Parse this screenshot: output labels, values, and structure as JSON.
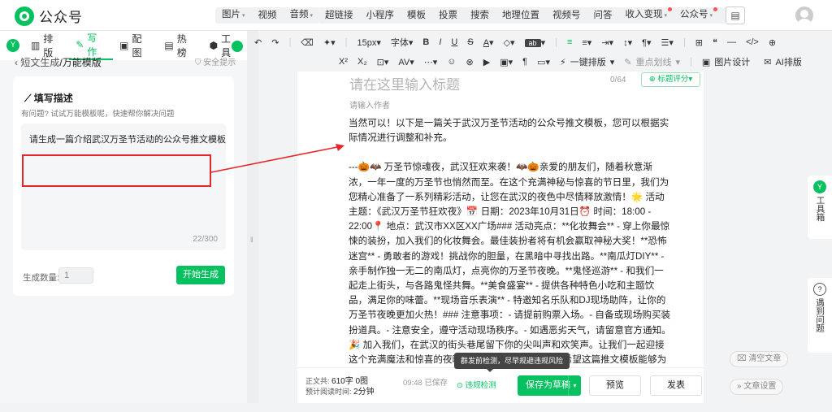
{
  "app": {
    "name": "公众号"
  },
  "nav1": [
    "图片",
    "视频",
    "音频"
  ],
  "nav2": [
    "超链接",
    "小程序",
    "模板",
    "投票",
    "搜索",
    "地理位置",
    "视频号",
    "问答",
    "收入变现",
    "公众号",
    "···"
  ],
  "left": {
    "tabs": [
      "排版",
      "写作",
      "配图",
      "热榜",
      "工具"
    ],
    "breadcrumb_prefix": "短文生成",
    "breadcrumb_current": "/万能模版",
    "safety": "安全提示",
    "card_title": "填写描述",
    "card_sub": "有问题? 试试万能模板呢，快速帮你解决问题",
    "input_value": "请生成一篇介绍武汉万圣节活动的公众号推文模板",
    "char_count": "22/300",
    "gen_label": "生成数量:",
    "gen_value": "1",
    "gen_button": "开始生成"
  },
  "toolbar": {
    "row1": [
      "↶",
      "↷",
      "|",
      "◆",
      "▾",
      "|",
      "15px",
      "字体",
      "B",
      "I",
      "U",
      "S",
      "A",
      "◇",
      "ab",
      "|",
      "≡",
      "≡",
      "≡",
      "|",
      "¶",
      "|",
      "≣",
      "|",
      "⊞",
      "“",
      "—",
      "</>",
      "⊕"
    ],
    "row2": [
      "X²",
      "X₂",
      "|",
      "A▾",
      "|",
      "⌚",
      "☺",
      "⊕",
      "▶",
      "▣",
      "|",
      "一键排版",
      "重点划线",
      "|",
      "图片设计",
      "AI排版"
    ]
  },
  "editor": {
    "title_placeholder": "请在这里输入标题",
    "title_count": "0/64",
    "score_label": "标题评分",
    "author_placeholder": "请输入作者",
    "p1": "当然可以！以下是一篇关于武汉万圣节活动的公众号推文模板，您可以根据实际情况进行调整和补充。",
    "p2": "---🎃🦇 万圣节惊魂夜，武汉狂欢来袭！🦇🎃亲爱的朋友们，随着秋意渐浓，一年一度的万圣节也悄然而至。在这个充满神秘与惊喜的节日里，我们为您精心准备了一系列精彩活动，让您在武汉的夜色中尽情释放激情！🌟 活动主题：《武汉万圣节狂欢夜》📅 日期：2023年10月31日⏰ 时间：18:00 - 22:00📍 地点：武汉市XX区XX广场### 活动亮点：**化妆舞会** - 穿上你最惊悚的装扮，加入我们的化妆舞会。最佳装扮者将有机会赢取神秘大奖！**恐怖迷宫** - 勇敢者的游戏！挑战你的胆量，在黑暗中寻找出路。**南瓜灯DIY** - 亲手制作独一无二的南瓜灯，点亮你的万圣节夜晚。**鬼怪巡游** - 和我们一起走上街头，与各路鬼怪共舞。**美食盛宴** - 提供各种特色小吃和主题饮品，满足你的味蕾。**现场音乐表演** - 特邀知名乐队和DJ现场助阵，让你的万圣节夜晚更加火热！### 注意事项：- 请提前购票入场。- 自备或现场购买装扮道具。- 注意安全，遵守活动现场秩序。- 如遇恶劣天气，请留意官方通知。🎉 加入我们，在武汉的街头巷尾留下你的尖叫声和欢笑声。让我们一起迎接这个充满魔法和惊喜的夜晚！🎟️ [点击购票](链接)---希望这篇推文模板能够为您的活动宣传提供帮助。记得在发布前检查所有细节是否准确无误，并确保所有链接都是有效的。祝您的活动圆满成功！"
  },
  "footer": {
    "text_label": "正文共:",
    "text_value": "610字 0图",
    "read_label": "预计阅读时间:",
    "read_value": "2分钟",
    "saved": "09:48 已保存",
    "check": "违规检测",
    "save": "保存为草稿",
    "preview": "预览",
    "publish": "发表",
    "tooltip": "群发前检测，尽早规避违规风险"
  },
  "right": {
    "tool": "工具箱",
    "question": "遇到问题",
    "clear": "清空文章",
    "settings": "文章设置"
  },
  "colors": {
    "accent": "#07c160",
    "annotation": "#e5262b"
  }
}
